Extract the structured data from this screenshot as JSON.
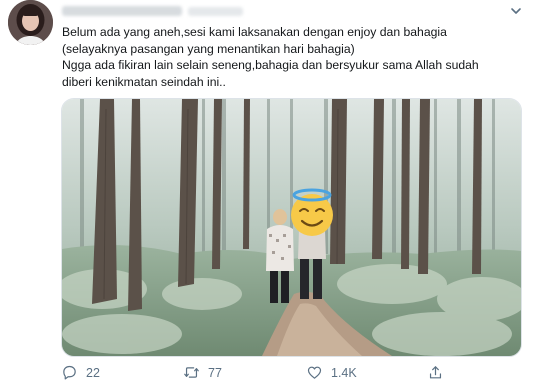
{
  "tweet": {
    "lines": [
      "Belum ada yang aneh,sesi kami laksanakan dengan enjoy dan bahagia",
      "(selayaknya pasangan yang menantikan hari bahagia)",
      "Ngga ada fikiran lain selain seneng,bahagia dan bersyukur sama Allah sudah",
      "diberi kenikmatan seindah ini.."
    ],
    "avatar_icon": "user-avatar-photo",
    "media_icon": "forest-couple-photo",
    "face_emoji_icon": "smiling-face-with-halo-icon"
  },
  "actions": {
    "reply_count": "22",
    "retweet_count": "77",
    "like_count": "1.4K",
    "reply_icon": "reply-icon",
    "retweet_icon": "retweet-icon",
    "like_icon": "heart-icon",
    "share_icon": "share-icon"
  },
  "colors": {
    "action_gray": "#5b7083",
    "text": "#14171a",
    "forest_green": "#8aa48c",
    "emoji_yellow": "#f7c948",
    "halo_blue": "#4aa3e0"
  }
}
